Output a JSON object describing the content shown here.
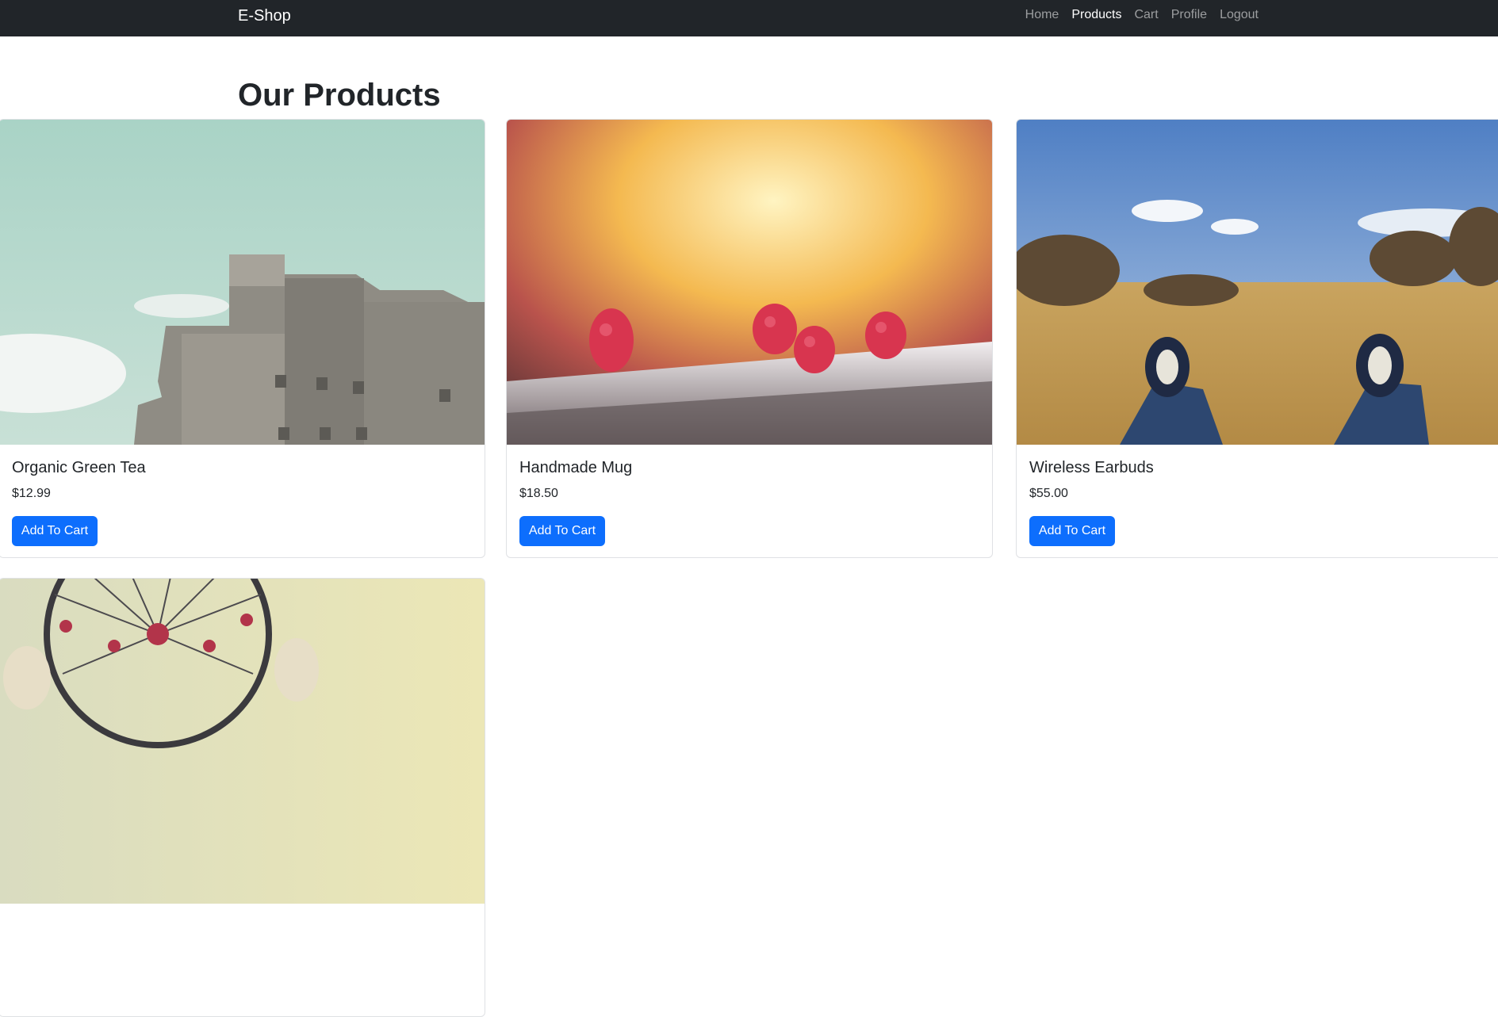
{
  "nav": {
    "brand": "E-Shop",
    "links": [
      {
        "label": "Home",
        "active": false
      },
      {
        "label": "Products",
        "active": true
      },
      {
        "label": "Cart",
        "active": false
      },
      {
        "label": "Profile",
        "active": false
      },
      {
        "label": "Logout",
        "active": false
      }
    ]
  },
  "page": {
    "title": "Our Products"
  },
  "products": [
    {
      "name": "Organic Green Tea",
      "price": "$12.99",
      "button": "Add To Cart",
      "image": "concrete-building-photo"
    },
    {
      "name": "Handmade Mug",
      "price": "$18.50",
      "button": "Add To Cart",
      "image": "raspberries-on-ledge-photo"
    },
    {
      "name": "Wireless Earbuds",
      "price": "$55.00",
      "button": "Add To Cart",
      "image": "sneakers-on-field-photo"
    },
    {
      "name": "",
      "price": "",
      "button": "",
      "image": "dreamcatcher-photo"
    }
  ],
  "colors": {
    "navbar_bg": "#212529",
    "primary": "#0d6efd",
    "text": "#212529"
  }
}
